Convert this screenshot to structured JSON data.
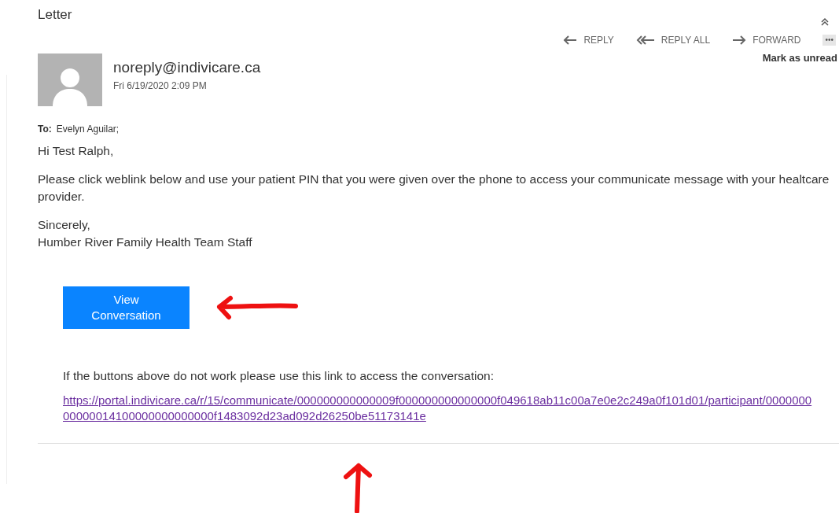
{
  "window": {
    "title": "Letter"
  },
  "actions": [
    {
      "kind": "reply",
      "label": "REPLY"
    },
    {
      "kind": "reply_all",
      "label": "REPLY ALL"
    },
    {
      "kind": "forward",
      "label": "FORWARD"
    },
    {
      "kind": "more",
      "label": "•••"
    }
  ],
  "mark_unread": "Mark as unread",
  "sender": {
    "address": "noreply@indivicare.ca",
    "date": "Fri 6/19/2020 2:09 PM"
  },
  "to": {
    "label": "To:",
    "value": "Evelyn Aguilar;"
  },
  "body": {
    "greeting": "Hi Test Ralph,",
    "paragraph": "Please click weblink below and use your patient PIN that you were given over the phone to access your communicate message with your healtcare provider.",
    "closing": "Sincerely,",
    "signature": "Humber River Family Health Team Staff"
  },
  "button": {
    "lines": [
      "View",
      "Conversation"
    ]
  },
  "fallback": "If the buttons above do not work please use this link to access the conversation:",
  "link": "https://portal.indivicare.ca/r/15/communicate/000000000000009f000000000000000f049618ab11c00a7e0e2c249a0f101d01/participant/000000000000014100000000000000f1483092d23ad092d26250be51173141e"
}
